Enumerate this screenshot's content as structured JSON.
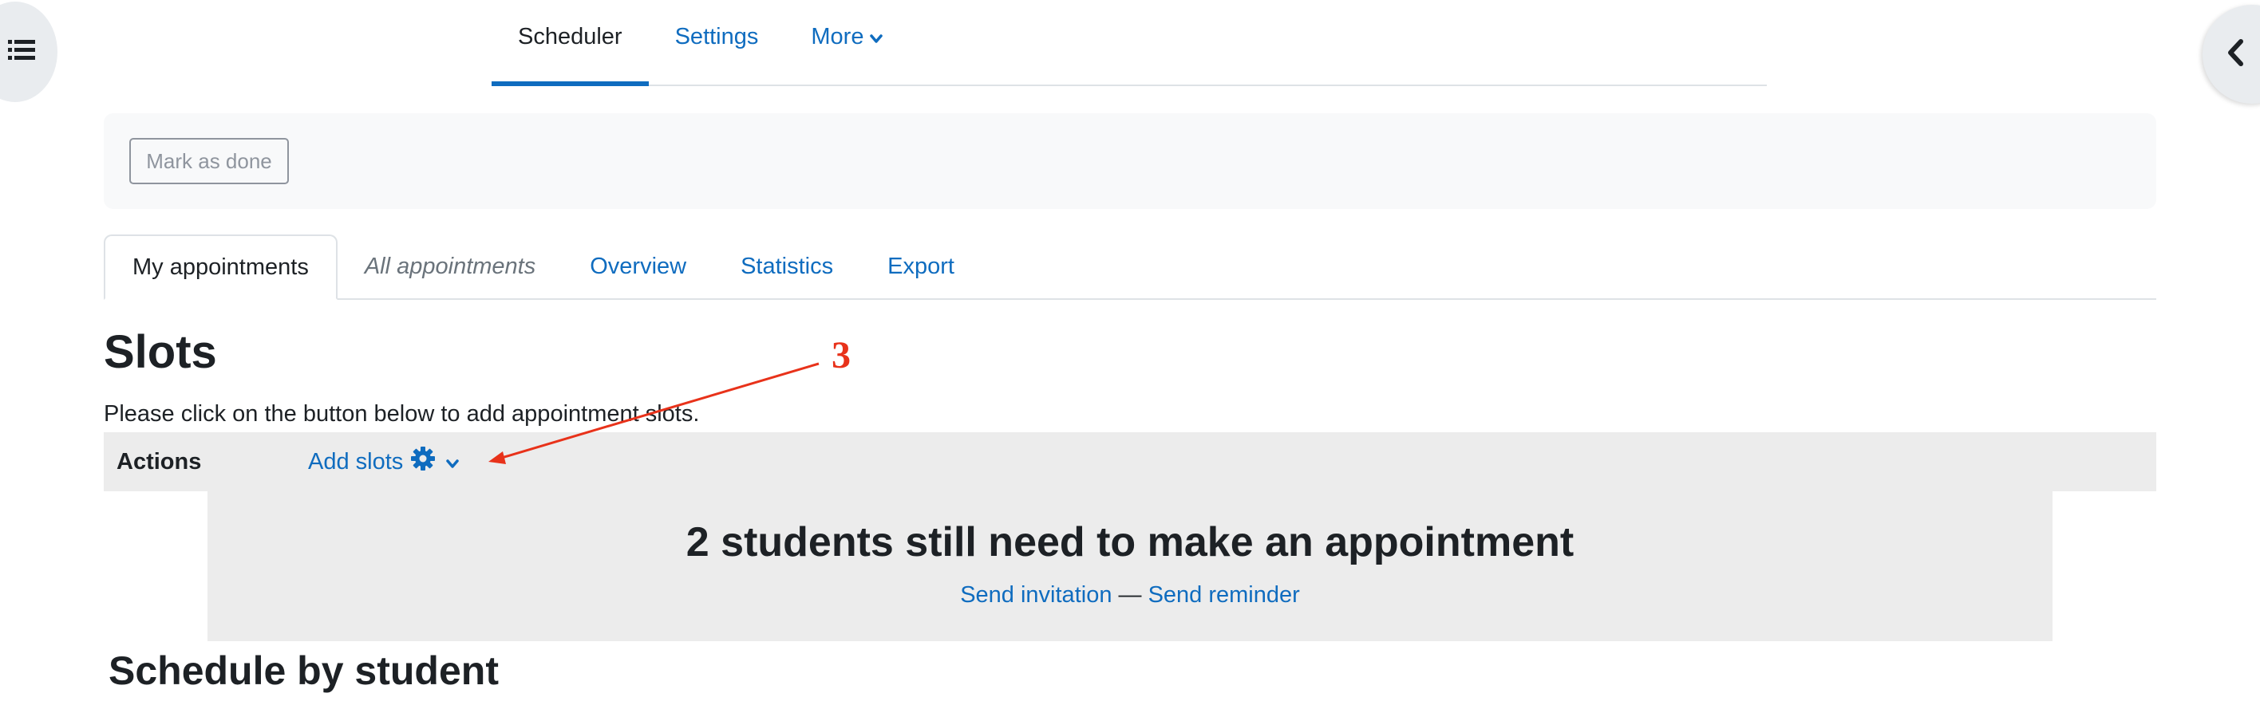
{
  "colors": {
    "link": "#0f6cbf",
    "annotation": "#e8321a",
    "bar": "#ececec"
  },
  "drawer": {
    "left_icon": "list-icon",
    "right_icon": "chevron-left-icon"
  },
  "topnav": {
    "tabs": [
      {
        "label": "Scheduler",
        "active": true
      },
      {
        "label": "Settings",
        "active": false
      },
      {
        "label": "More",
        "active": false
      }
    ]
  },
  "activity": {
    "mark_done_label": "Mark as done"
  },
  "subtabs": [
    {
      "label": "My appointments",
      "active": true
    },
    {
      "label": "All appointments",
      "active": false
    },
    {
      "label": "Overview",
      "active": false
    },
    {
      "label": "Statistics",
      "active": false
    },
    {
      "label": "Export",
      "active": false
    }
  ],
  "slots": {
    "heading": "Slots",
    "instruction": "Please click on the button below to add appointment slots."
  },
  "actions": {
    "label": "Actions",
    "add_slots_label": "Add slots"
  },
  "notice": {
    "title": "2 students still need to make an appointment",
    "invite_link": "Send invitation",
    "separator": "—",
    "reminder_link": "Send reminder"
  },
  "schedule_heading": "Schedule by student",
  "annotation": {
    "number": "3"
  }
}
